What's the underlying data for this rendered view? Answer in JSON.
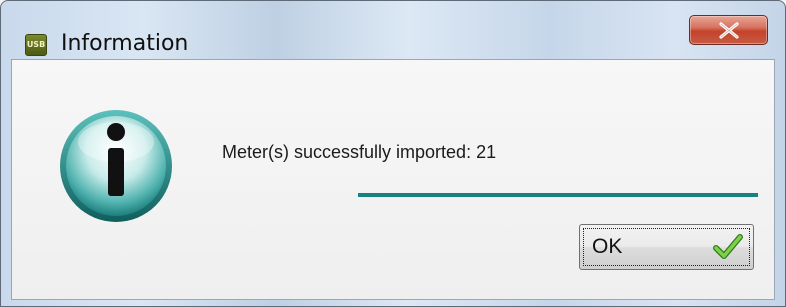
{
  "window": {
    "title": "Information",
    "app_icon_text": "USB",
    "close_icon": "close-x-icon"
  },
  "dialog": {
    "icon": "info-icon",
    "message": "Meter(s) successfully imported: 21",
    "progress_fraction": 1.0,
    "ok_label": "OK",
    "ok_icon": "checkmark-icon"
  },
  "colors": {
    "accent": "#178381",
    "close_button": "#c4432c"
  }
}
